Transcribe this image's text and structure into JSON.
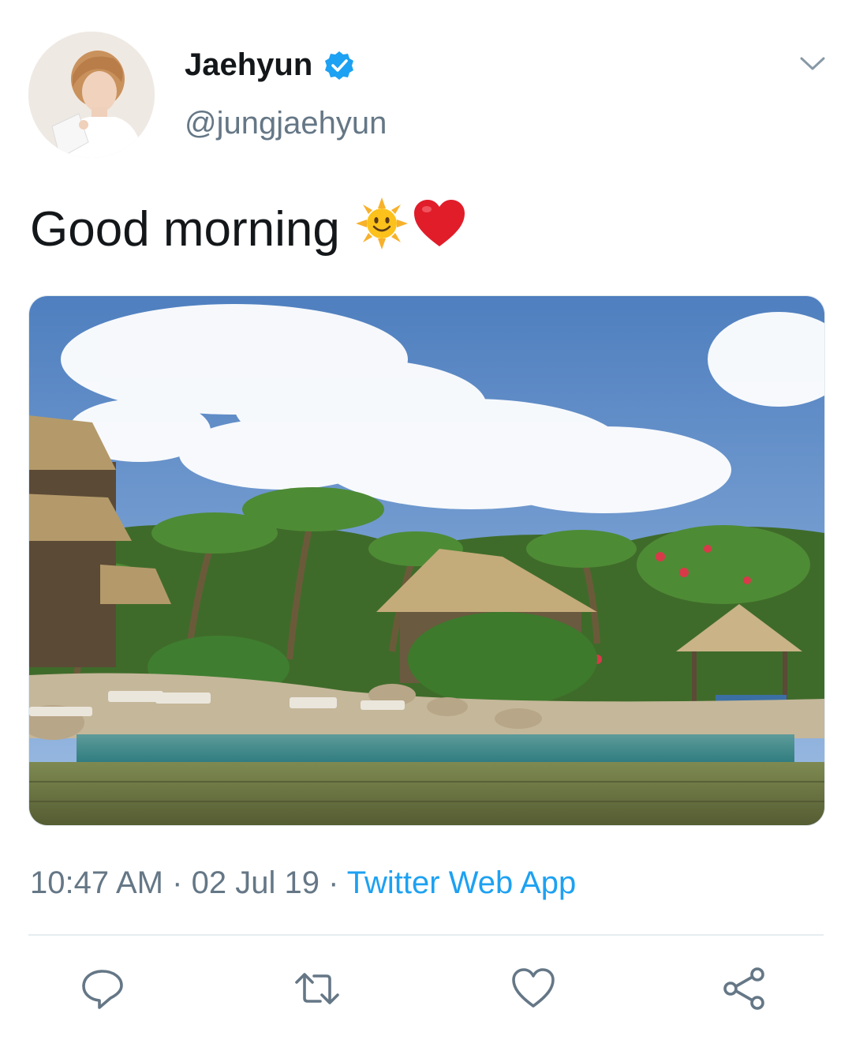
{
  "tweet": {
    "display_name": "Jaehyun",
    "handle": "@jungjaehyun",
    "text": "Good morning",
    "time": "10:47 AM",
    "separator": "·",
    "date": "02 Jul 19",
    "source": "Twitter Web App",
    "media_alt": "tropical resort pool with thatched huts and palm trees"
  },
  "icons": {
    "verified": "verified-badge-icon",
    "caret": "chevron-down-icon",
    "reply": "reply-icon",
    "retweet": "retweet-icon",
    "like": "heart-icon",
    "share": "share-icon",
    "emoji_sun": "sun-with-face",
    "emoji_heart": "red-heart"
  },
  "colors": {
    "text": "#14171a",
    "secondary": "#657786",
    "link": "#1da1f2",
    "icon": "#657786"
  }
}
